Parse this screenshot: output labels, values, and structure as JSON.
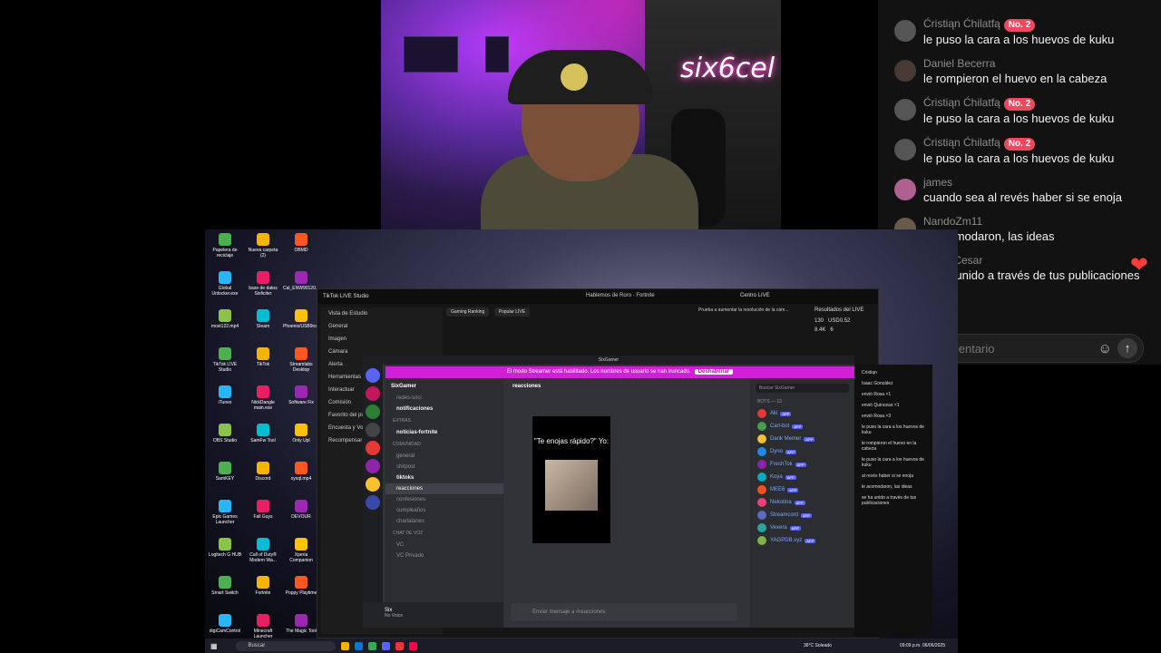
{
  "webcam": {
    "neon_sign": "six6cel"
  },
  "chat": {
    "messages": [
      {
        "name": "Ćristiąn Ćhilatfą",
        "badge": "No. 2",
        "text": "le puso la cara a los huevos de kuku",
        "avatar_color": "#555"
      },
      {
        "name": "Daniel Becerra",
        "badge": "",
        "text": "le rompieron el huevo en la cabeza",
        "avatar_color": "#4a3a35"
      },
      {
        "name": "Ćristiąn Ćhilatfą",
        "badge": "No. 2",
        "text": "le puso la cara a los huevos de kuku",
        "avatar_color": "#555"
      },
      {
        "name": "Ćristiąn Ćhilatfą",
        "badge": "No. 2",
        "text": "le puso la cara a los huevos de kuku",
        "avatar_color": "#555"
      },
      {
        "name": "james",
        "badge": "",
        "text": "cuando sea al revés haber si se enoja",
        "avatar_color": "#b06090"
      },
      {
        "name": "NandoZm11",
        "badge": "",
        "text": "le acomodaron, las ideas",
        "avatar_color": "#6a5a4a"
      },
      {
        "name": "CISO-Cesar",
        "badge": "",
        "text": "se ha unido a través de tus publicaciones",
        "avatar_color": "#777"
      }
    ],
    "input_placeholder": "Añadir comentario"
  },
  "desktop": {
    "icons": [
      "Papelera de reciclaje",
      "Nueva carpeta (2)",
      "OBMD",
      "Global Unlocker.exe",
      "base de datos Sixficiter",
      "Cal_ENW90120...",
      "most122.mp4",
      "Steam",
      "Phoenix/USB9ro...",
      "TikTok LIVE Studio",
      "TikTok",
      "Streamlabs Desktop",
      "iTunes",
      "NickDangle main.exe",
      "Software Fix",
      "OBS Studio",
      "SamFw Tool",
      "Only Upl",
      "SamKEY",
      "Discord",
      "xyxql.mp4",
      "Epic Games Launcher",
      "Fall Guys",
      "DEVOUR",
      "Logitech G HUB",
      "Call of Duty® Modern Wa...",
      "Xperia Companion",
      "Smart Switch",
      "Fortnite",
      "Poppy Playtime",
      "digiCamControl",
      "Minecraft Launcher",
      "The Magic Tool"
    ]
  },
  "tiktok_studio": {
    "title": "TikTok LIVE Studio",
    "center_title": "Hablemos de Roro · Fortnite",
    "centro_live": "Centro LIVE",
    "tabs": [
      "Gaming Ranking",
      "Popular LIVE"
    ],
    "left_rows": [
      "Vista de Estudio",
      "General",
      "Imagen",
      "Cámara",
      "Alerta",
      "Herramientas",
      "Interactuar",
      "Comisión",
      "Favorito del público",
      "Encuesta y Votar con...",
      "Recompensar de juegos"
    ],
    "banner": "Prueba a aumentar la resolución de la cám...",
    "results_label": "Resultados del LIVE",
    "stats": [
      "130",
      "USD0.52",
      "8.4K",
      "6"
    ]
  },
  "discord": {
    "window_title": "SixGamer",
    "notice": "El modo Streamer está habilitado. Los nombres de usuario se han truncado.",
    "notice_button": "Deshabilitar",
    "server_name": "SixGamer",
    "channels": [
      {
        "label": "redes-soci",
        "style": "ch"
      },
      {
        "label": "notificaciones",
        "style": "ch bold"
      },
      {
        "label": "EXTRAS",
        "style": "cat"
      },
      {
        "label": "noticias-fortnite",
        "style": "ch bold"
      },
      {
        "label": "COMUNIDAD",
        "style": "cat"
      },
      {
        "label": "general",
        "style": "ch"
      },
      {
        "label": "shitpost",
        "style": "ch"
      },
      {
        "label": "tiktoks",
        "style": "ch bold"
      },
      {
        "label": "reacciones",
        "style": "ch act"
      },
      {
        "label": "confesiones",
        "style": "ch"
      },
      {
        "label": "cumpleaños",
        "style": "ch"
      },
      {
        "label": "charlatanes",
        "style": "ch"
      },
      {
        "label": "CHAT DE VOZ",
        "style": "cat"
      },
      {
        "label": "VC",
        "style": "ch"
      },
      {
        "label": "VC Privado",
        "style": "ch"
      }
    ],
    "channel_header": "reacciones",
    "post_text": "\"Te enojas rápido?\" Yo:",
    "compose_placeholder": "Enviar mensaje a #reacciones",
    "user_name": "Six",
    "user_status": "No Voice",
    "search_placeholder": "Buscar SixGamer",
    "members_label": "BOTS — 13",
    "members": [
      "Aki",
      "Carl-bot",
      "Dank Memer",
      "Dyno",
      "FreshTok",
      "Koya",
      "MEE6",
      "Nekotina",
      "Streamcord",
      "Vexera",
      "YAGPDB.xyz"
    ],
    "app_badge": "APP"
  },
  "mini_chat": [
    "Cristiąn",
    "Isaac González",
    "envió Rosa ×1",
    "envió Quinceas ×1",
    "envió Rosa ×3",
    "le puso la cara a los huevos de kuku",
    "le rompieron el huevo en la cabeza",
    "le puso la cara a los huevos de kuku",
    "al revés haber si se enoja",
    "le acomodaron, las ideas",
    "se ha unido a través de tus publicaciones"
  ],
  "taskbar": {
    "search_label": "Buscar",
    "weather": "36°C Soleado",
    "clock": "09:09 p.m. 06/06/2025"
  }
}
